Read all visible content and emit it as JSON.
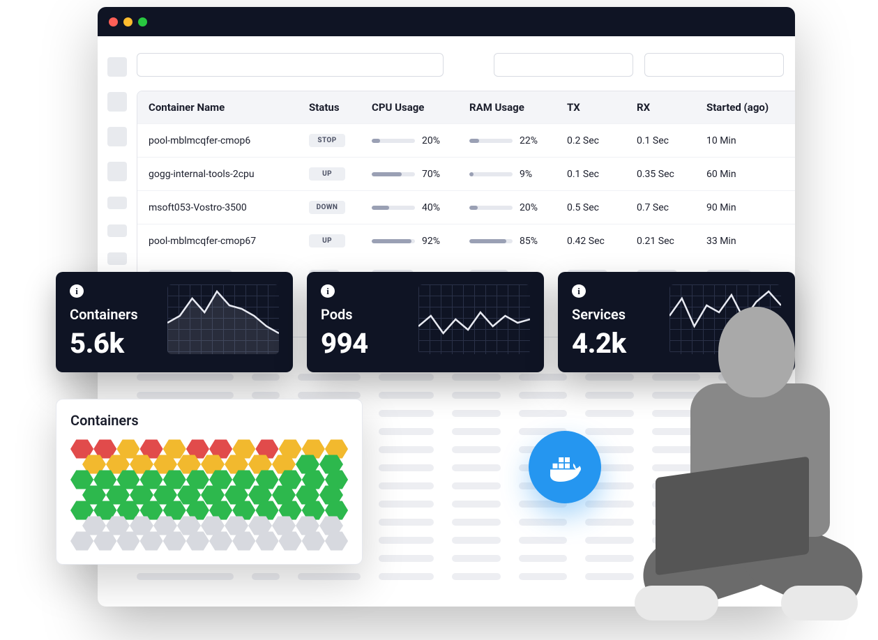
{
  "table": {
    "headers": {
      "name": "Container Name",
      "status": "Status",
      "cpu": "CPU Usage",
      "ram": "RAM Usage",
      "tx": "TX",
      "rx": "RX",
      "started": "Started (ago)"
    },
    "rows": [
      {
        "name": "pool-mblmcqfer-cmop6",
        "status": "STOP",
        "cpu_pct": 20,
        "cpu_label": "20%",
        "ram_pct": 22,
        "ram_label": "22%",
        "tx": "0.2 Sec",
        "rx": "0.1 Sec",
        "started": "10 Min"
      },
      {
        "name": "gogg-internal-tools-2cpu",
        "status": "UP",
        "cpu_pct": 70,
        "cpu_label": "70%",
        "ram_pct": 9,
        "ram_label": "9%",
        "tx": "0.1 Sec",
        "rx": "0.35 Sec",
        "started": "60 Min"
      },
      {
        "name": "msoft053-Vostro-3500",
        "status": "DOWN",
        "cpu_pct": 40,
        "cpu_label": "40%",
        "ram_pct": 20,
        "ram_label": "20%",
        "tx": "0.5 Sec",
        "rx": "0.7 Sec",
        "started": "90 Min"
      },
      {
        "name": "pool-mblmcqfer-cmop67",
        "status": "UP",
        "cpu_pct": 92,
        "cpu_label": "92%",
        "ram_pct": 85,
        "ram_label": "85%",
        "tx": "0.42 Sec",
        "rx": "0.21 Sec",
        "started": "33 Min"
      }
    ]
  },
  "kpis": {
    "containers": {
      "label": "Containers",
      "value": "5.6k"
    },
    "pods": {
      "label": "Pods",
      "value": "994"
    },
    "services": {
      "label": "Services",
      "value": "4.2k"
    }
  },
  "hex": {
    "title": "Containers",
    "rows": [
      [
        "red",
        "red",
        "yellow",
        "red",
        "yellow",
        "red",
        "red",
        "yellow",
        "red",
        "yellow",
        "yellow",
        "yellow"
      ],
      [
        "yellow",
        "yellow",
        "yellow",
        "yellow",
        "yellow",
        "yellow",
        "yellow",
        "yellow",
        "yellow",
        "green",
        "green"
      ],
      [
        "green",
        "green",
        "green",
        "green",
        "green",
        "green",
        "green",
        "green",
        "green",
        "green",
        "green",
        "green"
      ],
      [
        "green",
        "green",
        "green",
        "green",
        "green",
        "green",
        "green",
        "green",
        "green",
        "green",
        "green"
      ],
      [
        "green",
        "green",
        "green",
        "green",
        "green",
        "green",
        "green",
        "green",
        "green",
        "green",
        "green",
        "green"
      ],
      [
        "grey",
        "grey",
        "grey",
        "grey",
        "grey",
        "grey",
        "grey",
        "grey",
        "grey",
        "grey",
        "grey"
      ],
      [
        "grey",
        "grey",
        "grey",
        "grey",
        "grey",
        "grey",
        "grey",
        "grey",
        "grey",
        "grey",
        "grey",
        "grey"
      ]
    ]
  },
  "chart_data": [
    {
      "type": "line",
      "title": "Containers",
      "x": [
        0,
        1,
        2,
        3,
        4,
        5,
        6,
        7,
        8,
        9
      ],
      "values": [
        45,
        55,
        80,
        60,
        90,
        70,
        65,
        55,
        40,
        30
      ],
      "ylim": [
        0,
        100
      ]
    },
    {
      "type": "line",
      "title": "Pods",
      "x": [
        0,
        1,
        2,
        3,
        4,
        5,
        6,
        7,
        8,
        9
      ],
      "values": [
        40,
        55,
        30,
        50,
        35,
        60,
        40,
        55,
        45,
        50
      ],
      "ylim": [
        0,
        100
      ]
    },
    {
      "type": "line",
      "title": "Services",
      "x": [
        0,
        1,
        2,
        3,
        4,
        5,
        6,
        7,
        8,
        9
      ],
      "values": [
        55,
        80,
        40,
        70,
        60,
        85,
        50,
        75,
        90,
        70
      ],
      "ylim": [
        0,
        100
      ]
    }
  ],
  "colors": {
    "accent": "#2596f0",
    "status": {
      "red": "#e14b4b",
      "yellow": "#f2b92e",
      "green": "#2db84d",
      "grey": "#d7d9df"
    }
  },
  "bubble_icon": "docker-icon"
}
